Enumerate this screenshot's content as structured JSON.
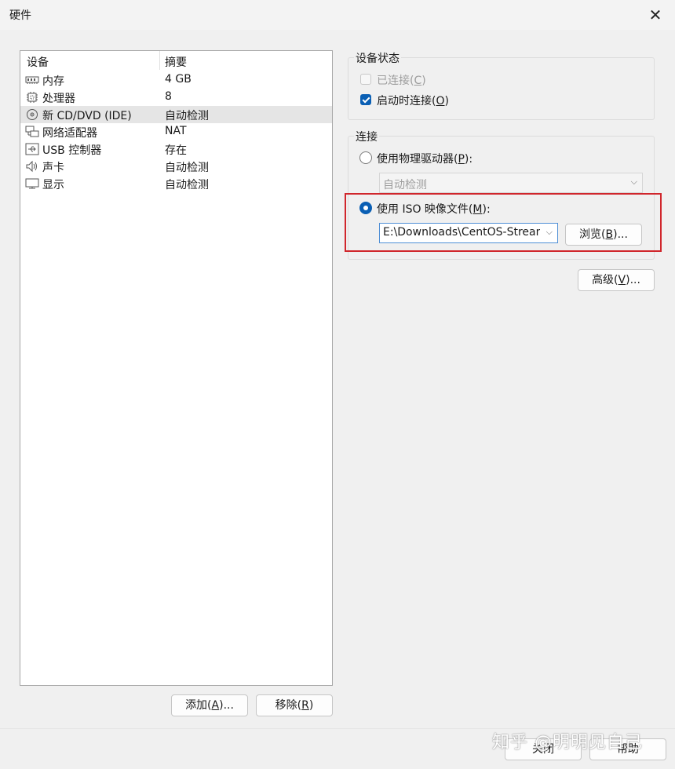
{
  "window": {
    "title": "硬件",
    "close_glyph": "✕"
  },
  "device_list": {
    "headers": {
      "device": "设备",
      "summary": "摘要"
    },
    "rows": [
      {
        "icon": "memory-icon",
        "name": "内存",
        "summary": "4 GB"
      },
      {
        "icon": "cpu-icon",
        "name": "处理器",
        "summary": "8"
      },
      {
        "icon": "cd-dvd-icon",
        "name": "新 CD/DVD (IDE)",
        "summary": "自动检测"
      },
      {
        "icon": "network-adapter-icon",
        "name": "网络适配器",
        "summary": "NAT"
      },
      {
        "icon": "usb-icon",
        "name": "USB 控制器",
        "summary": "存在"
      },
      {
        "icon": "sound-card-icon",
        "name": "声卡",
        "summary": "自动检测"
      },
      {
        "icon": "display-icon",
        "name": "显示",
        "summary": "自动检测"
      }
    ],
    "selected_index": 2
  },
  "buttons": {
    "add": {
      "text": "添加(",
      "key": "A",
      "suffix": ")..."
    },
    "remove": {
      "text": "移除(",
      "key": "R",
      "suffix": ")"
    },
    "browse": {
      "text": "浏览(",
      "key": "B",
      "suffix": ")..."
    },
    "advanced": {
      "text": "高级(",
      "key": "V",
      "suffix": ")..."
    },
    "close": "关闭",
    "help": "帮助"
  },
  "device_status": {
    "label": "设备状态",
    "connected": {
      "text": "已连接(",
      "key": "C",
      "suffix": ")",
      "checked": false,
      "disabled": true
    },
    "connect_at_power_on": {
      "text": "启动时连接(",
      "key": "O",
      "suffix": ")",
      "checked": true
    }
  },
  "connection": {
    "label": "连接",
    "physical_drive": {
      "text": "使用物理驱动器(",
      "key": "P",
      "suffix": "):",
      "selected": false,
      "value": "自动检测"
    },
    "iso_image": {
      "text": "使用 ISO 映像文件(",
      "key": "M",
      "suffix": "):",
      "selected": true,
      "value": "E:\\Downloads\\CentOS-Stream-"
    }
  },
  "watermark": "知乎 @明明见自己",
  "colors": {
    "accent": "#0a5fb4",
    "highlight_border": "#d0262c"
  }
}
